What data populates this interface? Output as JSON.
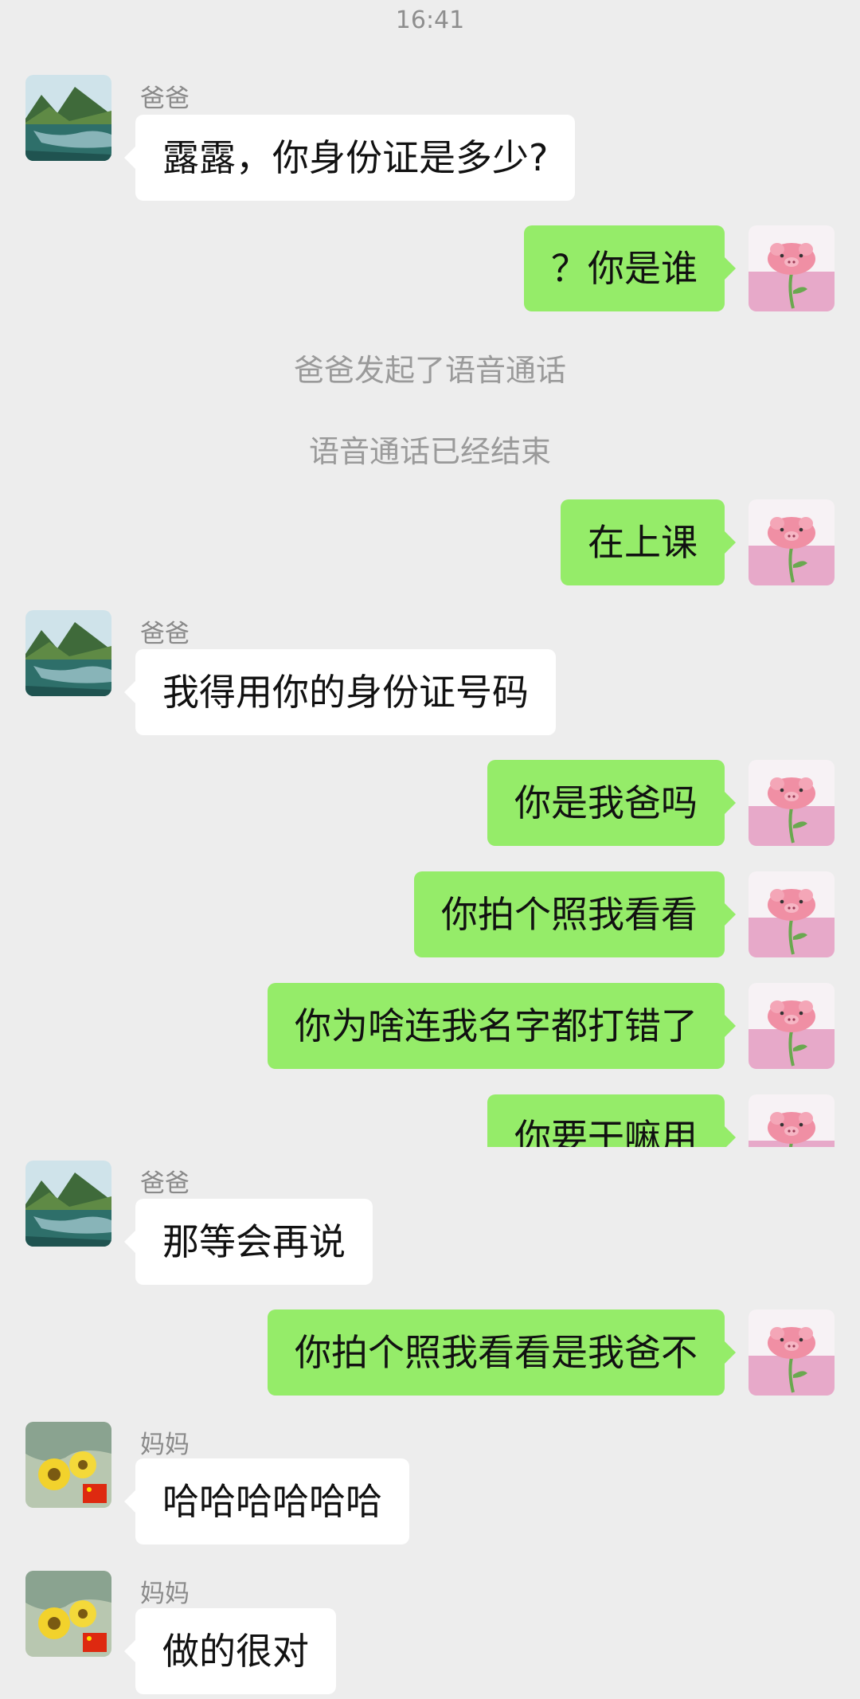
{
  "status": {
    "time": "16:41"
  },
  "system_messages": {
    "call_started": "爸爸发起了语音通话",
    "call_ended": "语音通话已经结束"
  },
  "contacts": {
    "dad": "爸爸",
    "mom": "妈妈"
  },
  "messages": [
    {
      "from": "dad",
      "text": "露露，你身份证是多少?"
    },
    {
      "from": "me",
      "text": "？你是谁"
    },
    {
      "from": "me",
      "text": "在上课"
    },
    {
      "from": "dad",
      "text": "我得用你的身份证号码"
    },
    {
      "from": "me",
      "text": "你是我爸吗"
    },
    {
      "from": "me",
      "text": "你拍个照我看看"
    },
    {
      "from": "me",
      "text": "你为啥连我名字都打错了"
    },
    {
      "from": "me",
      "text": "你要干嘛用"
    },
    {
      "from": "dad",
      "text": "那等会再说"
    },
    {
      "from": "me",
      "text": "你拍个照我看看是我爸不"
    },
    {
      "from": "mom",
      "text": "哈哈哈哈哈哈"
    },
    {
      "from": "mom",
      "text": "做的很对"
    }
  ],
  "colors": {
    "background": "#ededed",
    "outgoing_bubble": "#95ec69",
    "incoming_bubble": "#ffffff"
  },
  "icons": {
    "dad_avatar": "lake-landscape-avatar",
    "mom_avatar": "yellow-flowers-avatar",
    "my_avatar": "pink-pig-flower-avatar"
  }
}
